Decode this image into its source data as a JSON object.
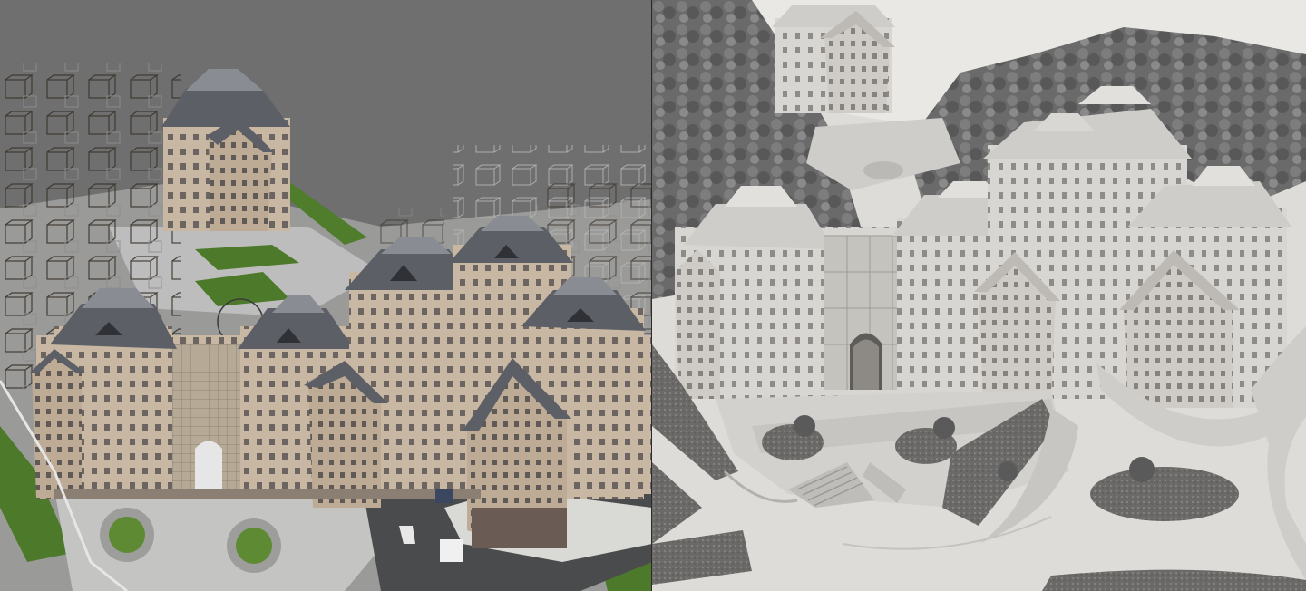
{
  "figure": {
    "panels": [
      {
        "name": "viewport-model",
        "icon": "viewport-3d-icon"
      },
      {
        "name": "clay-render",
        "icon": "render-icon"
      }
    ],
    "colors": {
      "viewport_bg": "#6f6f6f",
      "facade": "#c9b9a5",
      "roof": "#5d5f66",
      "grass": "#4d7a2a",
      "clay": "#dcdad6",
      "clay_shadow": "#a9a6a1",
      "tree": "#6c6c6c"
    }
  }
}
